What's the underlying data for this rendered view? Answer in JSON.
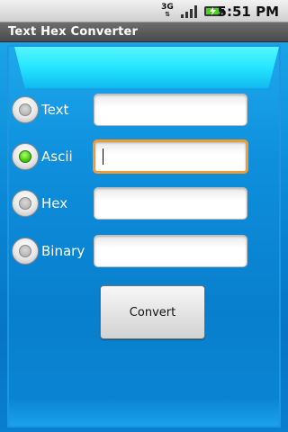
{
  "status_bar": {
    "network_type": "3G",
    "time": "5:51 PM",
    "icons": [
      "3g-data-icon",
      "signal-strength-icon",
      "battery-charging-icon"
    ]
  },
  "app": {
    "title": "Text Hex Converter"
  },
  "form": {
    "rows": [
      {
        "label": "Text",
        "selected": false,
        "value": "",
        "focused": false
      },
      {
        "label": "Ascii",
        "selected": true,
        "value": "",
        "focused": true
      },
      {
        "label": "Hex",
        "selected": false,
        "value": "",
        "focused": false
      },
      {
        "label": "Binary",
        "selected": false,
        "value": "",
        "focused": false
      }
    ],
    "convert_label": "Convert"
  },
  "colors": {
    "accent_glow": "#25e6ff",
    "panel_blue": "#0a88d6",
    "focus_orange": "#f39b2f",
    "radio_checked_green": "#4ccf1b"
  }
}
